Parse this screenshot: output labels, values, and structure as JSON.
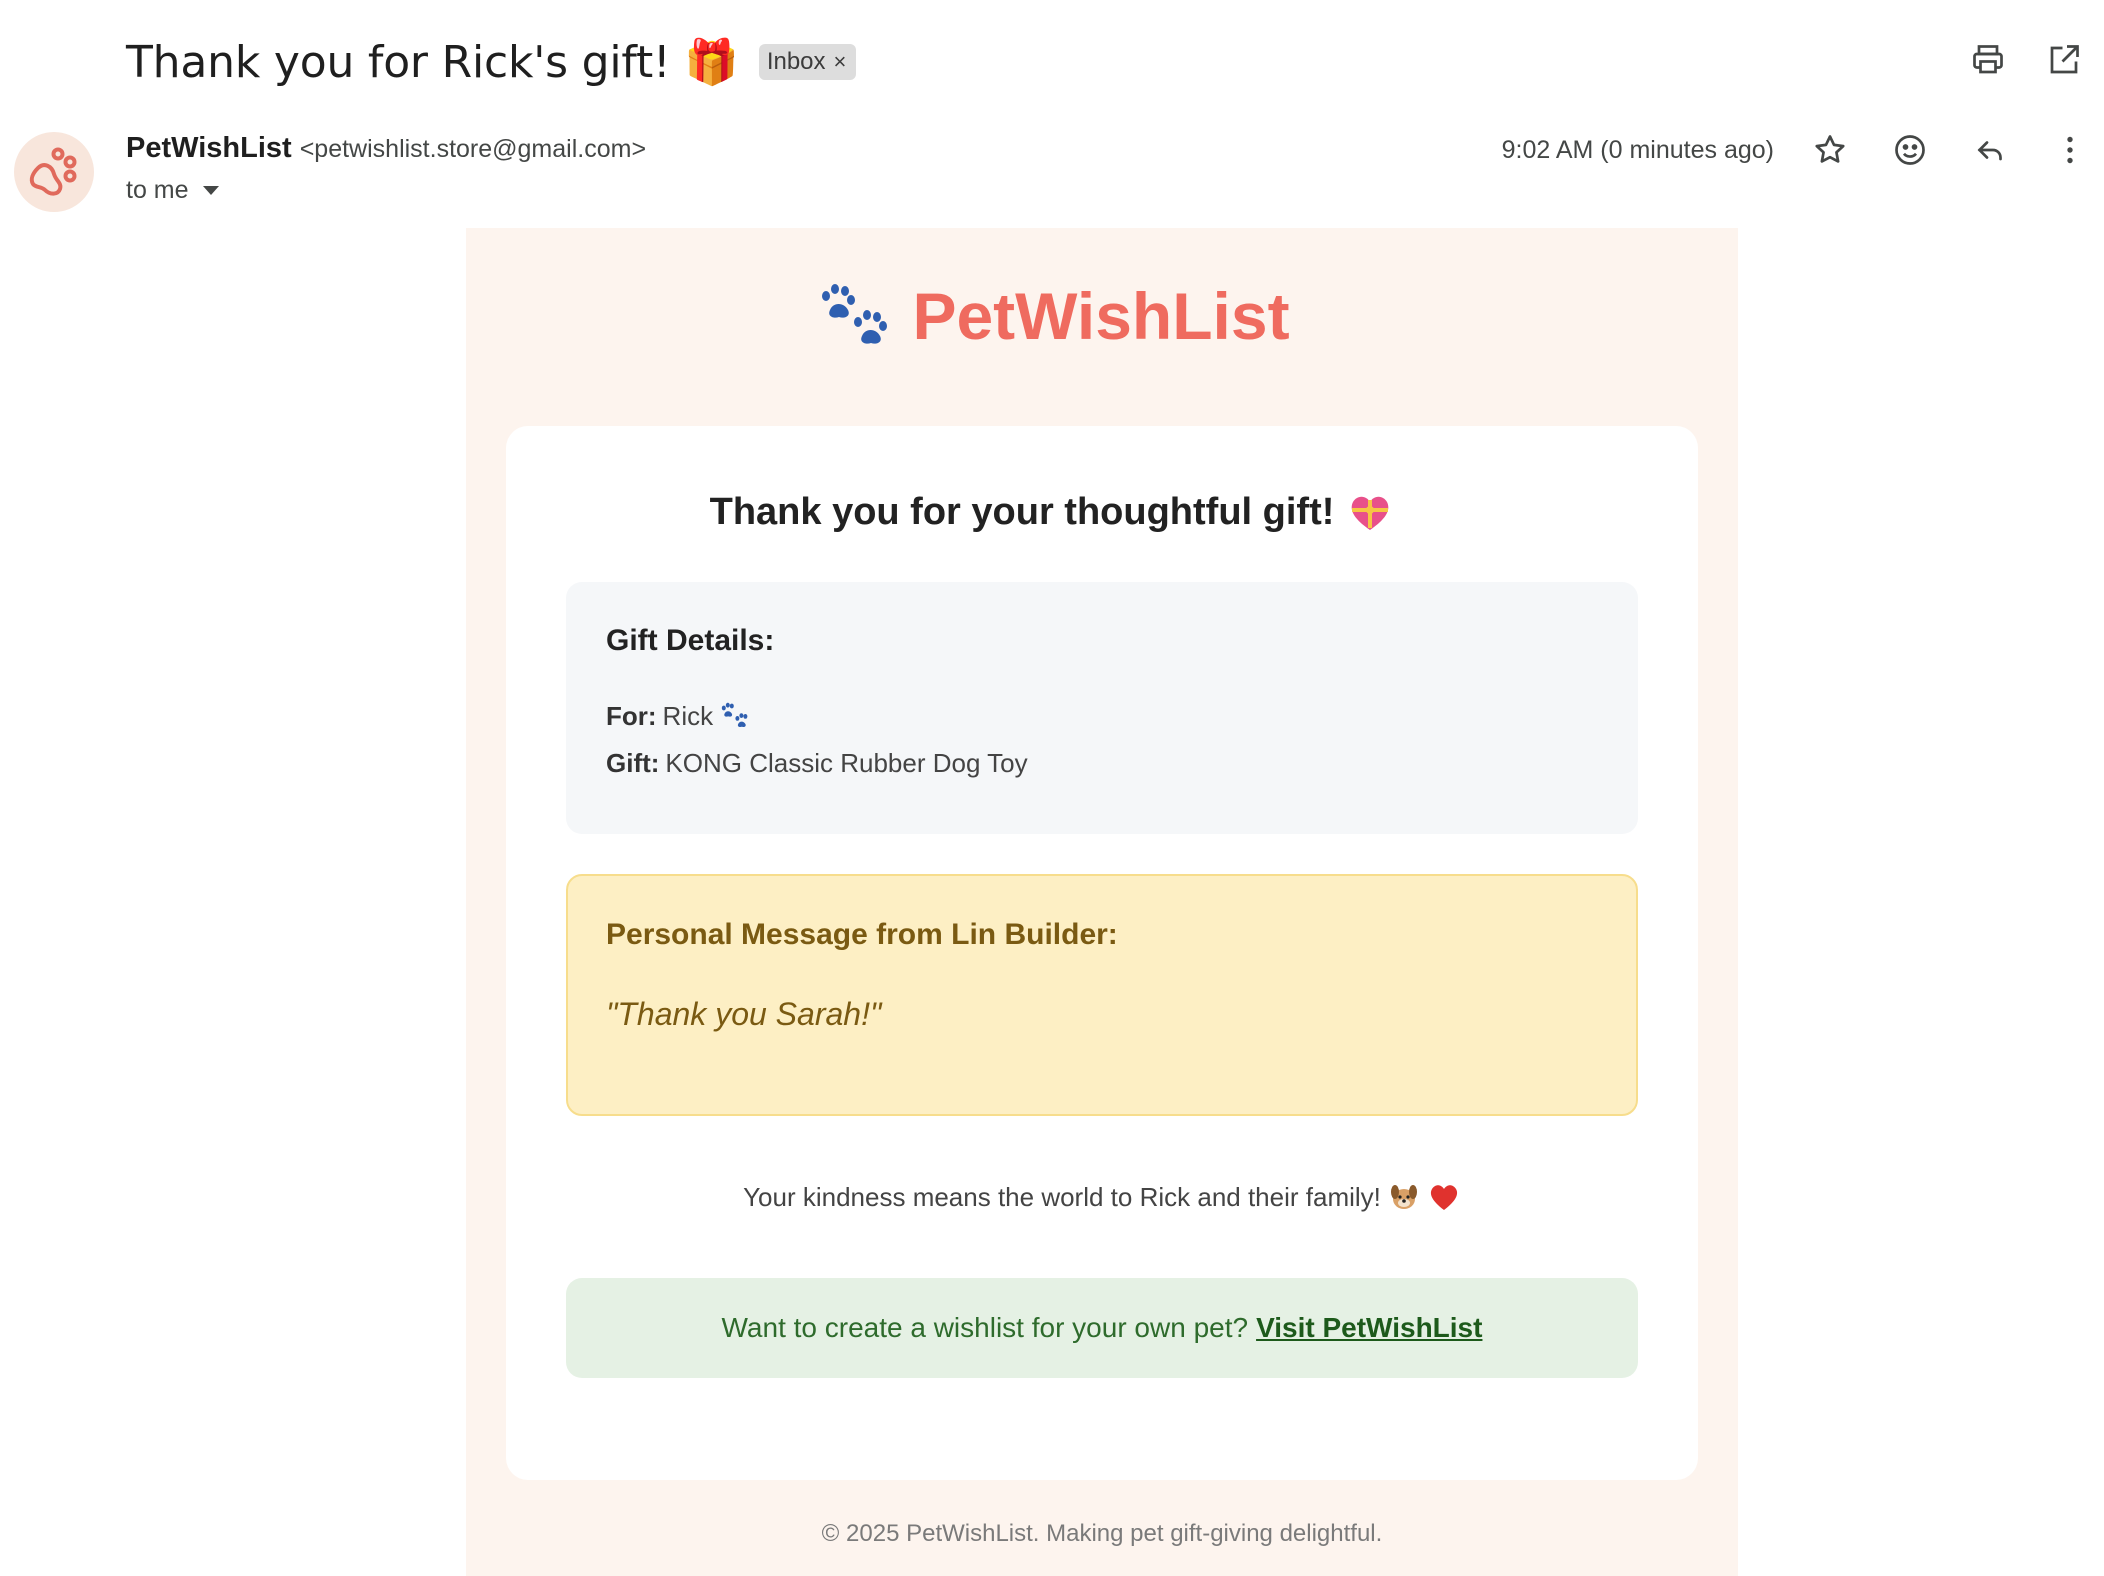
{
  "subject": {
    "title": "Thank you for Rick's gift! 🎁",
    "label_chip": "Inbox",
    "chip_remove": "×"
  },
  "sender": {
    "name": "PetWishList",
    "email": "<petwishlist.store@gmail.com>",
    "recipient": "to me",
    "timestamp": "9:02 AM (0 minutes ago)"
  },
  "email": {
    "brand": "PetWishList",
    "card_title": "Thank you for your thoughtful gift!",
    "details": {
      "heading": "Gift Details:",
      "for_label": "For:",
      "for_value": "Rick",
      "gift_label": "Gift:",
      "gift_value": "KONG Classic Rubber Dog Toy"
    },
    "message": {
      "heading": "Personal Message from Lin Builder:",
      "text": "\"Thank you Sarah!\""
    },
    "kindness": "Your kindness means the world to Rick and their family!",
    "cta": {
      "prompt": "Want to create a wishlist for your own pet?",
      "link": "Visit PetWishList"
    },
    "footer": "© 2025 PetWishList. Making pet gift-giving delightful."
  },
  "colors": {
    "brand": "#ef6b5f",
    "email_bg": "#fdf4ee",
    "message_bg": "#fdefc4",
    "cta_bg": "#e5f1e4"
  },
  "icons": [
    "print-icon",
    "open-in-new-window-icon",
    "star-icon",
    "emoji-reaction-icon",
    "reply-icon",
    "more-vert-icon",
    "paw-prints-icon",
    "gift-heart-icon",
    "dog-icon",
    "red-heart-icon"
  ]
}
